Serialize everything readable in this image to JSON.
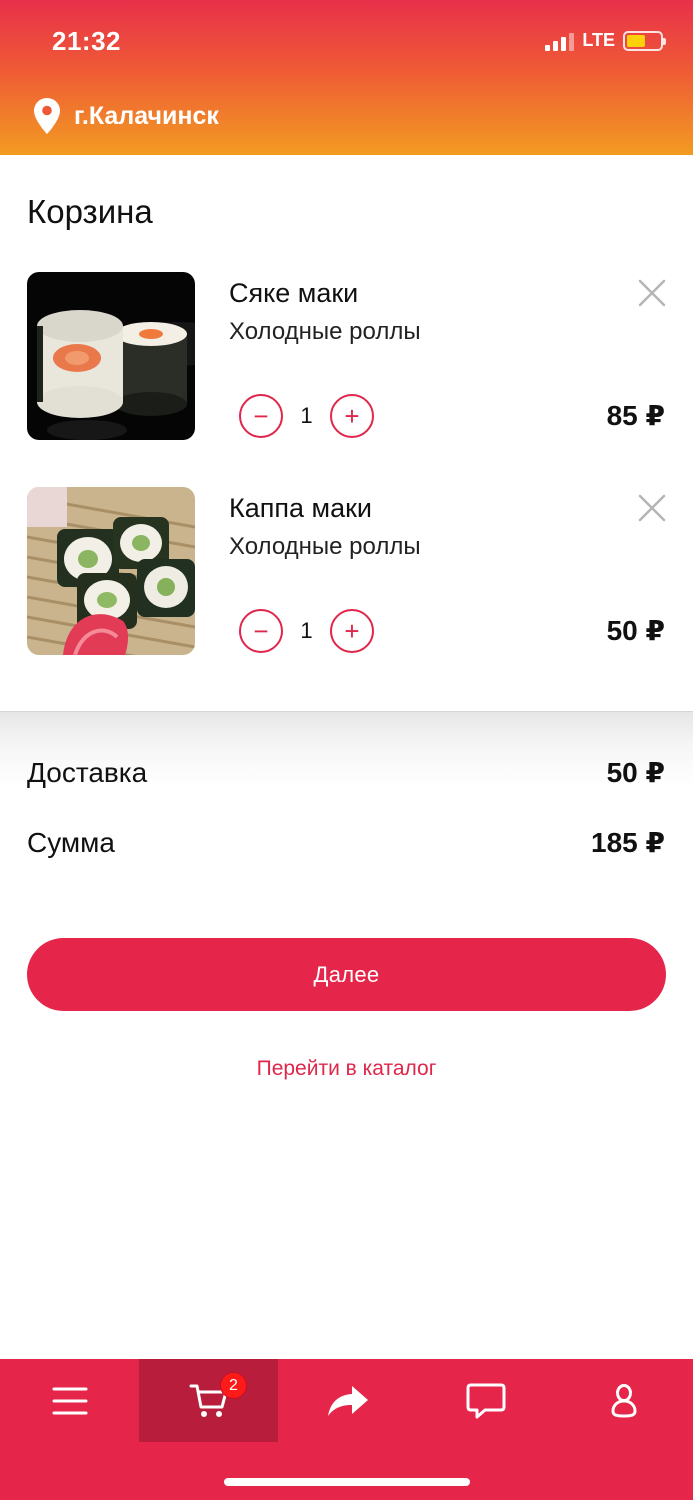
{
  "status_bar": {
    "time": "21:32",
    "network": "LTE",
    "battery_color": "#ffd10a"
  },
  "header": {
    "city": "г.Калачинск",
    "icon": "location-pin-icon"
  },
  "page": {
    "title": "Корзина"
  },
  "cart_items": [
    {
      "name": "Сяке маки",
      "category": "Холодные роллы",
      "quantity": "1",
      "price": "85 ₽",
      "minus": "−",
      "plus": "+"
    },
    {
      "name": "Каппа маки",
      "category": "Холодные роллы",
      "quantity": "1",
      "price": "50 ₽",
      "minus": "−",
      "plus": "+"
    }
  ],
  "summary": {
    "delivery_label": "Доставка",
    "delivery_value": "50 ₽",
    "total_label": "Сумма",
    "total_value": "185 ₽"
  },
  "actions": {
    "next_label": "Далее",
    "catalog_label": "Перейти в каталог"
  },
  "tabbar": {
    "items": [
      {
        "icon": "menu-icon"
      },
      {
        "icon": "cart-icon",
        "badge": "2",
        "active": true
      },
      {
        "icon": "share-icon"
      },
      {
        "icon": "chat-icon"
      },
      {
        "icon": "profile-icon"
      }
    ]
  },
  "colors": {
    "accent": "#e5264a",
    "accent_dark": "#b81e3b",
    "gradient_top": "#e8304a",
    "gradient_bottom": "#f29b22"
  }
}
